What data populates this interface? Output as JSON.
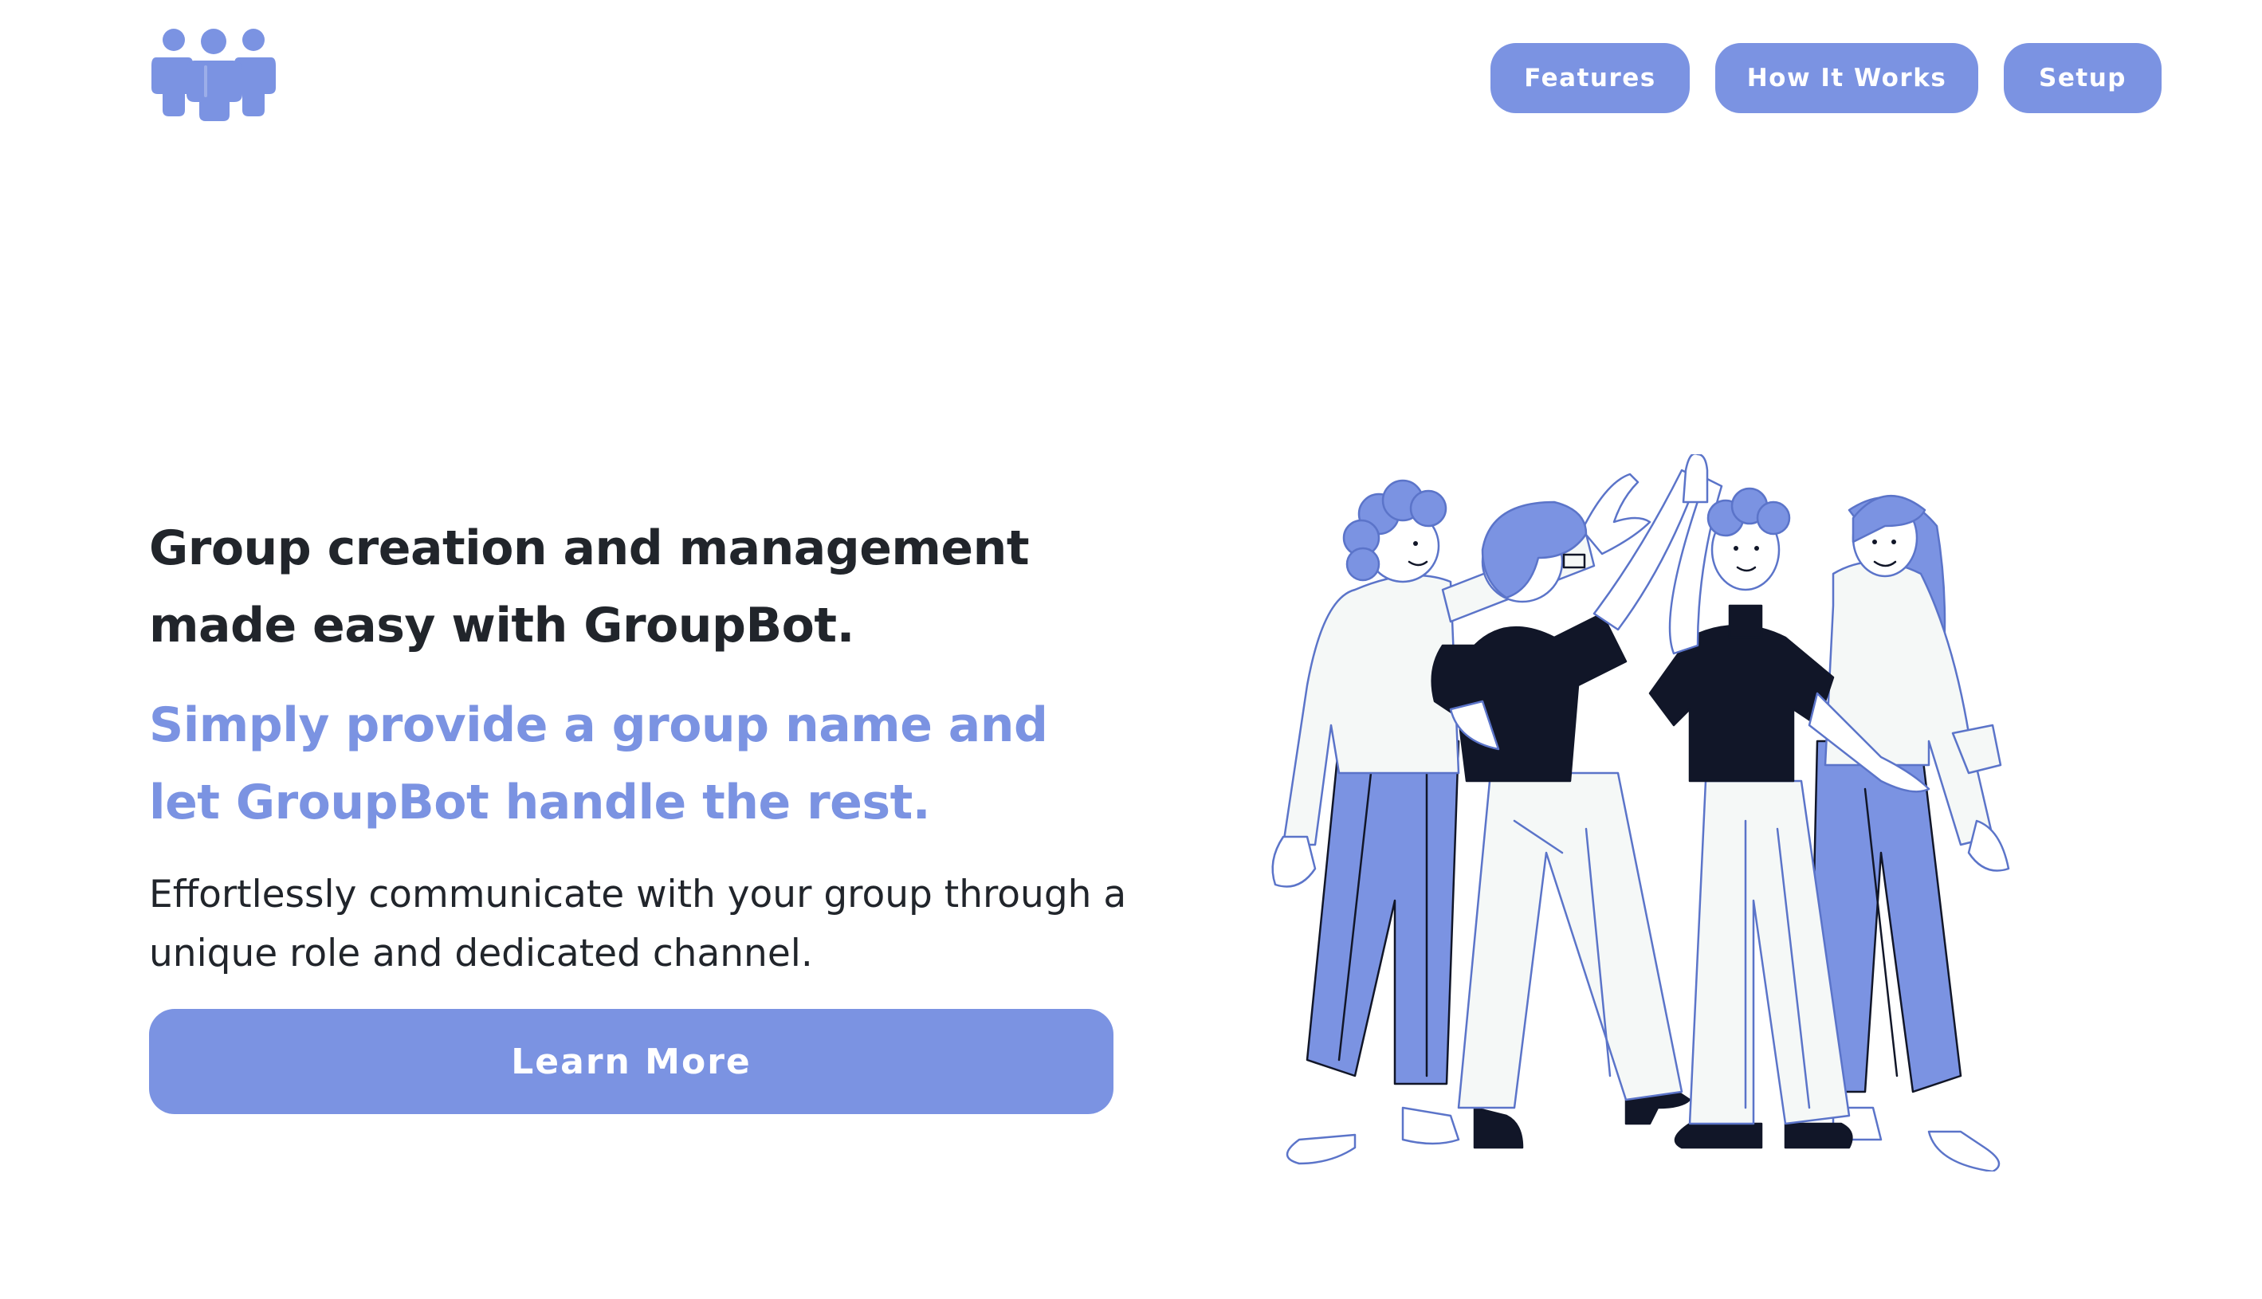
{
  "header": {
    "logo_icon": "group-people-icon",
    "nav": [
      {
        "label": "Features"
      },
      {
        "label": "How It Works"
      },
      {
        "label": "Setup"
      }
    ]
  },
  "hero": {
    "headline": "Group creation and management made easy with GroupBot.",
    "subheadline": "Simply provide a group name and let GroupBot handle the rest.",
    "body": "Effortlessly communicate with your group through a unique role and dedicated channel.",
    "cta_label": "Learn More",
    "illustration_icon": "people-high-five-illustration"
  },
  "colors": {
    "accent": "#7b93e2",
    "text_dark": "#21252b",
    "illustration_dark": "#111628",
    "illustration_light": "#f5f8f7"
  }
}
